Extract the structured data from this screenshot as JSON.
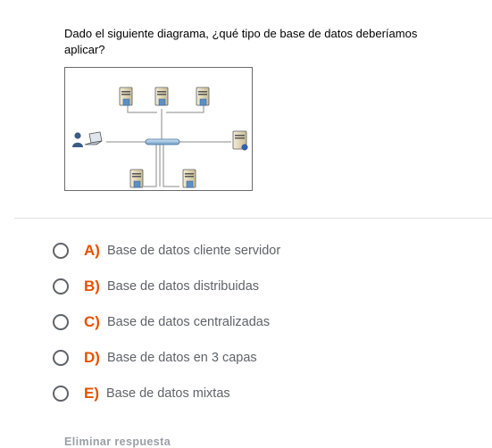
{
  "question": {
    "text": "Dado el siguiente diagrama, ¿qué tipo de base de datos deberíamos aplicar?"
  },
  "diagram": {
    "icons": [
      "user-icon",
      "laptop-icon",
      "server-icon",
      "database-server-icon",
      "network-hub-icon"
    ]
  },
  "options": [
    {
      "letter": "A)",
      "label": "Base de datos cliente servidor"
    },
    {
      "letter": "B)",
      "label": "Base de datos distribuidas"
    },
    {
      "letter": "C)",
      "label": "Base de datos centralizadas"
    },
    {
      "letter": "D)",
      "label": "Base de datos en 3 capas"
    },
    {
      "letter": "E)",
      "label": "Base de datos mixtas"
    }
  ],
  "actions": {
    "clear_label": "Eliminar respuesta"
  },
  "colors": {
    "accent": "#e65100",
    "option_text": "#5f6368",
    "radio_border": "#5f6368",
    "clear_link": "#9aa0a6"
  }
}
